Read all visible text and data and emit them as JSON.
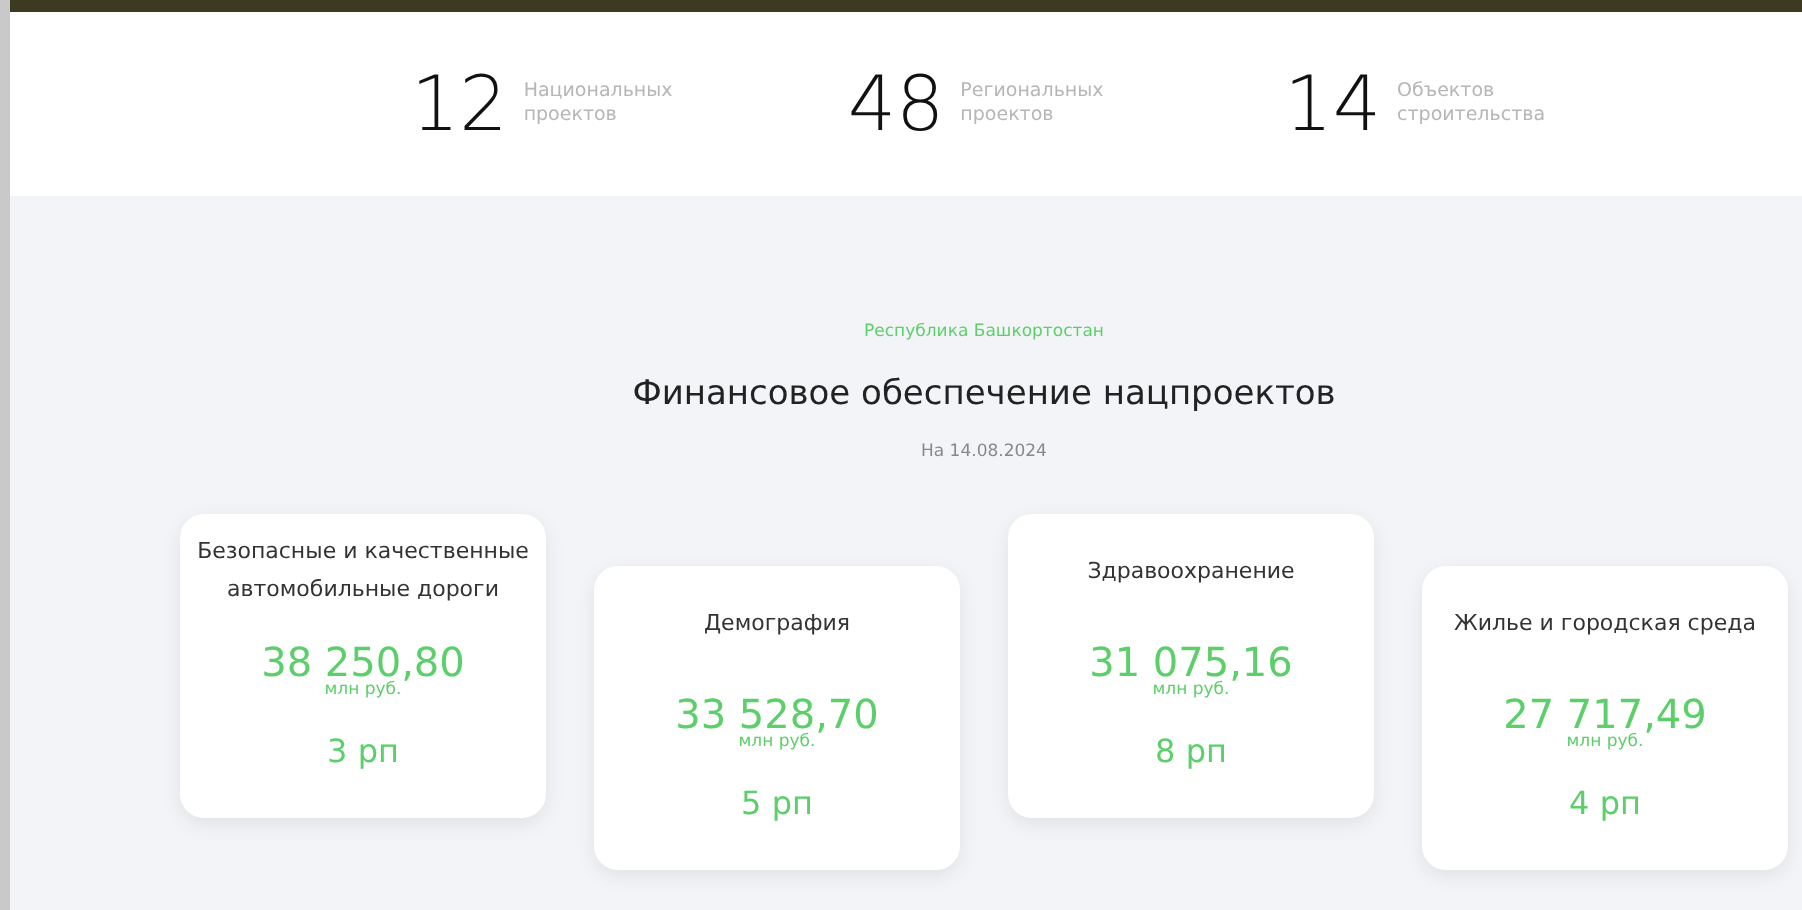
{
  "stats": [
    {
      "value": "12",
      "label": "Национальных проектов"
    },
    {
      "value": "48",
      "label": "Региональных проектов"
    },
    {
      "value": "14",
      "label": "Объектов строительства"
    }
  ],
  "section": {
    "region": "Республика Башкортостан",
    "title": "Финансовое обеспечение нацпроектов",
    "date": "На 14.08.2024"
  },
  "projects": [
    {
      "name": "Безопасные и качественные автомобильные дороги",
      "amount": "38 250,80",
      "unit": "млн руб.",
      "count": "3 рп"
    },
    {
      "name": "Демография",
      "amount": "33 528,70",
      "unit": "млн руб.",
      "count": "5 рп"
    },
    {
      "name": "Здравоохранение",
      "amount": "31 075,16",
      "unit": "млн руб.",
      "count": "8 рп"
    },
    {
      "name": "Жилье и городская среда",
      "amount": "27 717,49",
      "unit": "млн руб.",
      "count": "4 рп"
    }
  ]
}
